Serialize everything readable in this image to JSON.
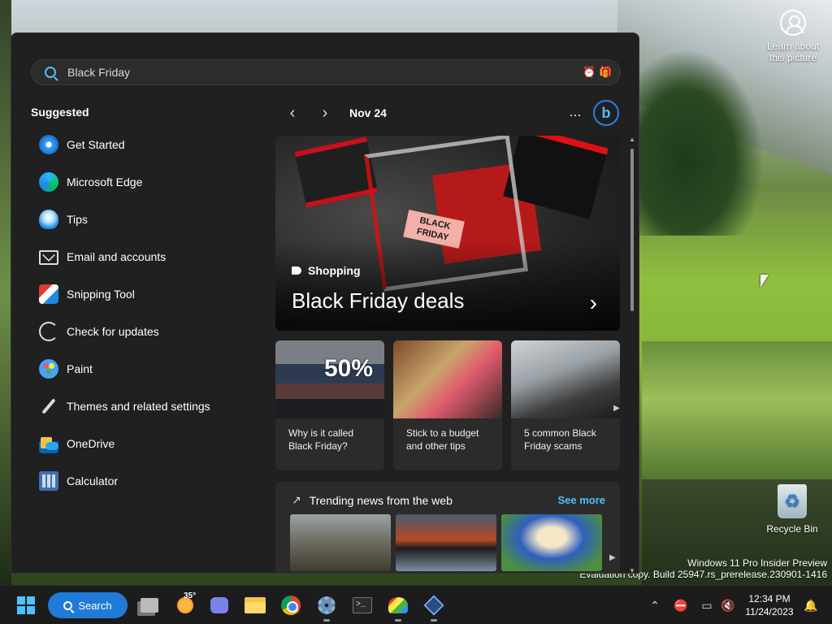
{
  "desktop": {
    "learn_label": "Learn about this picture",
    "recycle_bin_label": "Recycle Bin",
    "watermark_line1": "Windows 11 Pro Insider Preview",
    "watermark_line2": "Evaluation copy. Build 25947.rs_prerelease.230901-1416"
  },
  "search": {
    "query": "Black Friday",
    "icons": [
      "alarm-clock-icon",
      "gift-icon"
    ]
  },
  "suggested": {
    "heading": "Suggested",
    "items": [
      {
        "label": "Get Started",
        "icon": "get-started-icon"
      },
      {
        "label": "Microsoft Edge",
        "icon": "edge-icon"
      },
      {
        "label": "Tips",
        "icon": "tips-icon"
      },
      {
        "label": "Email and accounts",
        "icon": "mail-icon"
      },
      {
        "label": "Snipping Tool",
        "icon": "snipping-tool-icon"
      },
      {
        "label": "Check for updates",
        "icon": "refresh-icon"
      },
      {
        "label": "Paint",
        "icon": "paint-icon"
      },
      {
        "label": "Themes and related settings",
        "icon": "brush-icon"
      },
      {
        "label": "OneDrive",
        "icon": "onedrive-icon"
      },
      {
        "label": "Calculator",
        "icon": "calculator-icon"
      }
    ]
  },
  "highlights": {
    "date": "Nov 24",
    "more_label": "...",
    "bing_label": "b",
    "hero": {
      "category": "Shopping",
      "title": "Black Friday deals",
      "tag_text": "BLACK FRIDAY"
    },
    "cards": [
      {
        "caption": "Why is it called Black Friday?",
        "image_text": "50%"
      },
      {
        "caption": "Stick to a budget and other tips",
        "image_text": ""
      },
      {
        "caption": "5 common Black Friday scams",
        "image_text": ""
      }
    ],
    "trending": {
      "heading": "Trending news from the web",
      "see_more": "See more"
    }
  },
  "taskbar": {
    "search_label": "Search",
    "weather_temp": "35°",
    "clock_time": "12:34 PM",
    "clock_date": "11/24/2023"
  },
  "colors": {
    "accent": "#4cc2ff",
    "flyout_bg": "#202020",
    "taskbar_search": "#1f7ad8"
  }
}
